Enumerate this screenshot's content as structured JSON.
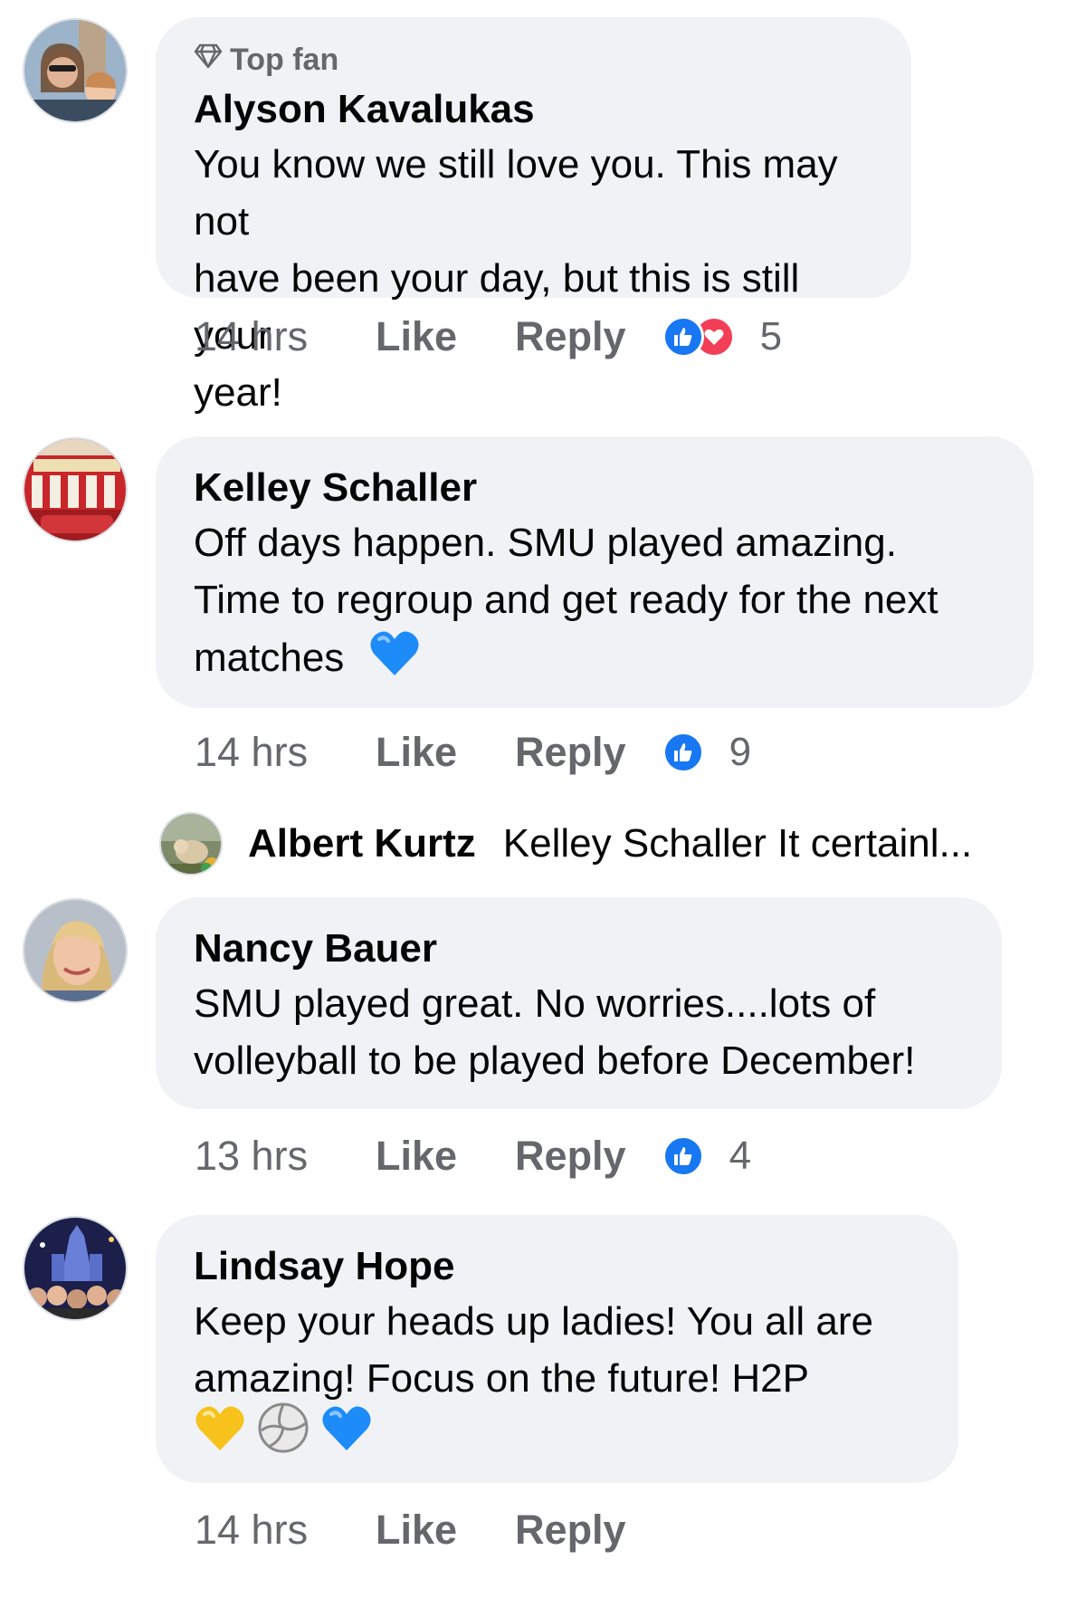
{
  "comments": [
    {
      "badge": "Top fan",
      "author": "Alyson Kavalukas",
      "lines": [
        "You know we still love you.  This may not",
        "have been your day, but this is still your",
        "year!"
      ],
      "time": "14 hrs",
      "like": "Like",
      "reply": "Reply",
      "reactions": [
        "like",
        "love"
      ],
      "reaction_count": "5"
    },
    {
      "author": "Kelley Schaller",
      "lines": [
        "Off days happen. SMU played amazing.",
        "Time to regroup and get ready for the next",
        "matches"
      ],
      "time": "14 hrs",
      "like": "Like",
      "reply": "Reply",
      "reactions": [
        "like"
      ],
      "reaction_count": "9"
    },
    {
      "author": "Nancy Bauer",
      "lines": [
        "SMU played great. No worries....lots of",
        "volleyball to be played before December!"
      ],
      "time": "13 hrs",
      "like": "Like",
      "reply": "Reply",
      "reactions": [
        "like"
      ],
      "reaction_count": "4"
    },
    {
      "author": "Lindsay Hope",
      "lines": [
        "Keep your heads up ladies! You all are",
        "amazing! Focus on the future! H2P"
      ],
      "time": "14 hrs",
      "like": "Like",
      "reply": "Reply"
    }
  ],
  "reply_preview": {
    "author": "Albert Kurtz",
    "text": "Kelley Schaller It certainl..."
  },
  "colors": {
    "bubble": "#f0f2f5",
    "meta": "#65676b",
    "like": "#1877f2",
    "love": "#f33e58",
    "blue_heart": "#1d8cf8",
    "yellow_heart": "#f7c21b"
  }
}
